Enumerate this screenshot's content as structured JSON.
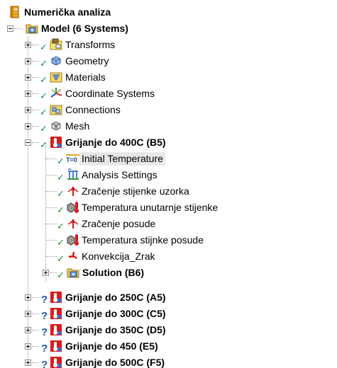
{
  "tree": {
    "root": {
      "label": "Numerička analiza",
      "icon": "project-book-icon"
    },
    "model": {
      "label": "Model (6 Systems)",
      "icon": "model-icon"
    },
    "model_children": [
      {
        "label": "Transforms",
        "icon": "transforms-icon",
        "status": "ok"
      },
      {
        "label": "Geometry",
        "icon": "geometry-icon",
        "status": "ok"
      },
      {
        "label": "Materials",
        "icon": "materials-icon",
        "status": "ok"
      },
      {
        "label": "Coordinate Systems",
        "icon": "coordinate-systems-icon",
        "status": "ok"
      },
      {
        "label": "Connections",
        "icon": "connections-icon",
        "status": "ok"
      },
      {
        "label": "Mesh",
        "icon": "mesh-icon",
        "status": "ok"
      }
    ],
    "analysis_b5": {
      "label": "Grijanje do 400C (B5)",
      "icon": "transient-thermal-icon",
      "status": "ok",
      "children": [
        {
          "label": "Initial Temperature",
          "icon": "initial-temperature-icon",
          "status": "ok",
          "icon_text": "T=0",
          "selected": true
        },
        {
          "label": "Analysis Settings",
          "icon": "analysis-settings-icon",
          "status": "ok"
        },
        {
          "label": "Zračenje stijenke uzorka",
          "icon": "radiation-icon",
          "status": "ok"
        },
        {
          "label": "Temperatura unutarnje stijenke",
          "icon": "temperature-icon",
          "status": "ok"
        },
        {
          "label": "Zračenje posude",
          "icon": "radiation-icon",
          "status": "ok"
        },
        {
          "label": "Temperatura stijnke posude",
          "icon": "temperature-icon",
          "status": "ok"
        },
        {
          "label": "Konvekcija_Zrak",
          "icon": "convection-fan-icon",
          "status": "ok"
        }
      ],
      "solution": {
        "label": "Solution (B6)",
        "icon": "solution-icon",
        "status": "ok"
      }
    },
    "other_analyses": [
      {
        "label": "Grijanje do 250C  (A5)",
        "icon": "transient-thermal-icon",
        "status": "q"
      },
      {
        "label": "Grijanje do 300C (C5)",
        "icon": "transient-thermal-icon",
        "status": "q"
      },
      {
        "label": "Grijanje do 350C (D5)",
        "icon": "transient-thermal-icon",
        "status": "q"
      },
      {
        "label": "Grijanje do 450 (E5)",
        "icon": "transient-thermal-icon",
        "status": "q"
      },
      {
        "label": "Grijanje do 500C (F5)",
        "icon": "transient-thermal-icon",
        "status": "q"
      }
    ],
    "status_glyphs": {
      "ok": "✓",
      "q": "?"
    },
    "colors": {
      "ok_check": "#0a9a2c",
      "question_mark": "#1b56c2",
      "thermal_red": "#d81c1c",
      "selection_bg": "#e8e8e8"
    }
  }
}
